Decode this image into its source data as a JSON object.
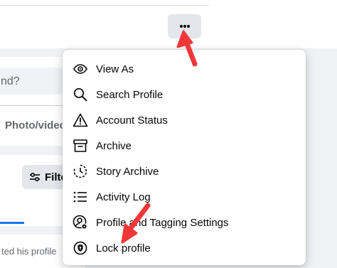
{
  "composer": {
    "placeholder": "nd?",
    "photo_video_label": "Photo/video"
  },
  "posts": {
    "filters_label": "Filte"
  },
  "activity": {
    "text": "ted his profile"
  },
  "menu": {
    "items": [
      {
        "label": "View As",
        "icon": "eye-icon"
      },
      {
        "label": "Search Profile",
        "icon": "search-icon"
      },
      {
        "label": "Account Status",
        "icon": "warning-icon"
      },
      {
        "label": "Archive",
        "icon": "archive-icon"
      },
      {
        "label": "Story Archive",
        "icon": "story-archive-icon"
      },
      {
        "label": "Activity Log",
        "icon": "activity-list-icon"
      },
      {
        "label": "Profile and Tagging Settings",
        "icon": "profile-settings-icon"
      },
      {
        "label": "Lock profile",
        "icon": "lock-shield-icon"
      }
    ]
  },
  "colors": {
    "accent": "#1877f2",
    "annotation_arrow": "#f0373a",
    "button_bg": "#e4e6eb",
    "page_bg": "#f0f2f5"
  }
}
